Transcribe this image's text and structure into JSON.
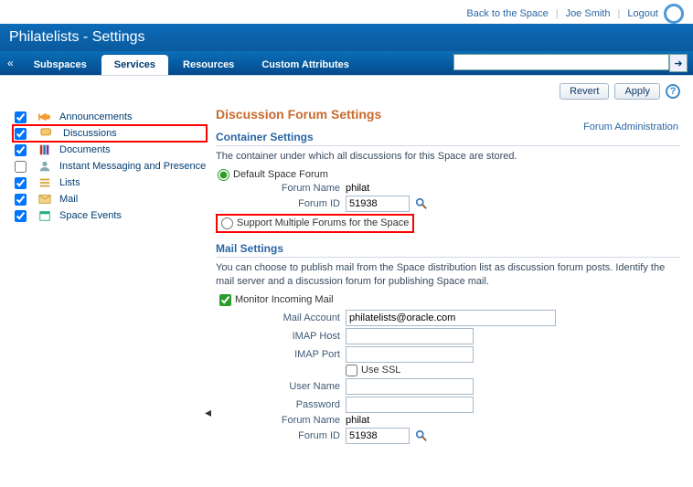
{
  "header": {
    "title": "Philatelists - Settings",
    "links": {
      "back": "Back to the Space",
      "user": "Joe Smith",
      "logout": "Logout"
    }
  },
  "tabs": {
    "items": [
      {
        "label": "Subspaces",
        "active": false
      },
      {
        "label": "Services",
        "active": true
      },
      {
        "label": "Resources",
        "active": false
      },
      {
        "label": "Custom Attributes",
        "active": false
      }
    ],
    "search_value": ""
  },
  "sidebar": {
    "items": [
      {
        "label": "Announcements",
        "checked": true
      },
      {
        "label": "Discussions",
        "checked": true
      },
      {
        "label": "Documents",
        "checked": true
      },
      {
        "label": "Instant Messaging and Presence",
        "checked": false
      },
      {
        "label": "Lists",
        "checked": true
      },
      {
        "label": "Mail",
        "checked": true
      },
      {
        "label": "Space Events",
        "checked": true
      }
    ]
  },
  "actions": {
    "revert": "Revert",
    "apply": "Apply"
  },
  "main": {
    "title": "Discussion Forum Settings",
    "admin_link": "Forum Administration",
    "container": {
      "heading": "Container Settings",
      "desc": "The container under which all discussions for this Space are stored.",
      "opt_default": "Default Space Forum",
      "opt_multi": "Support Multiple Forums for the Space",
      "forum_name_label": "Forum Name",
      "forum_name_value": "philat",
      "forum_id_label": "Forum ID",
      "forum_id_value": "51938"
    },
    "mail": {
      "heading": "Mail Settings",
      "desc": "You can choose to publish mail from the Space distribution list as discussion forum posts. Identify the mail server and a discussion forum for publishing Space mail.",
      "monitor_label": "Monitor Incoming Mail",
      "account_label": "Mail Account",
      "account_value": "philatelists@oracle.com",
      "imap_host_label": "IMAP Host",
      "imap_host_value": "",
      "imap_port_label": "IMAP Port",
      "imap_port_value": "",
      "ssl_label": "Use SSL",
      "user_label": "User Name",
      "user_value": "",
      "pass_label": "Password",
      "pass_value": "",
      "forum_name_label": "Forum Name",
      "forum_name_value": "philat",
      "forum_id_label": "Forum ID",
      "forum_id_value": "51938"
    }
  }
}
